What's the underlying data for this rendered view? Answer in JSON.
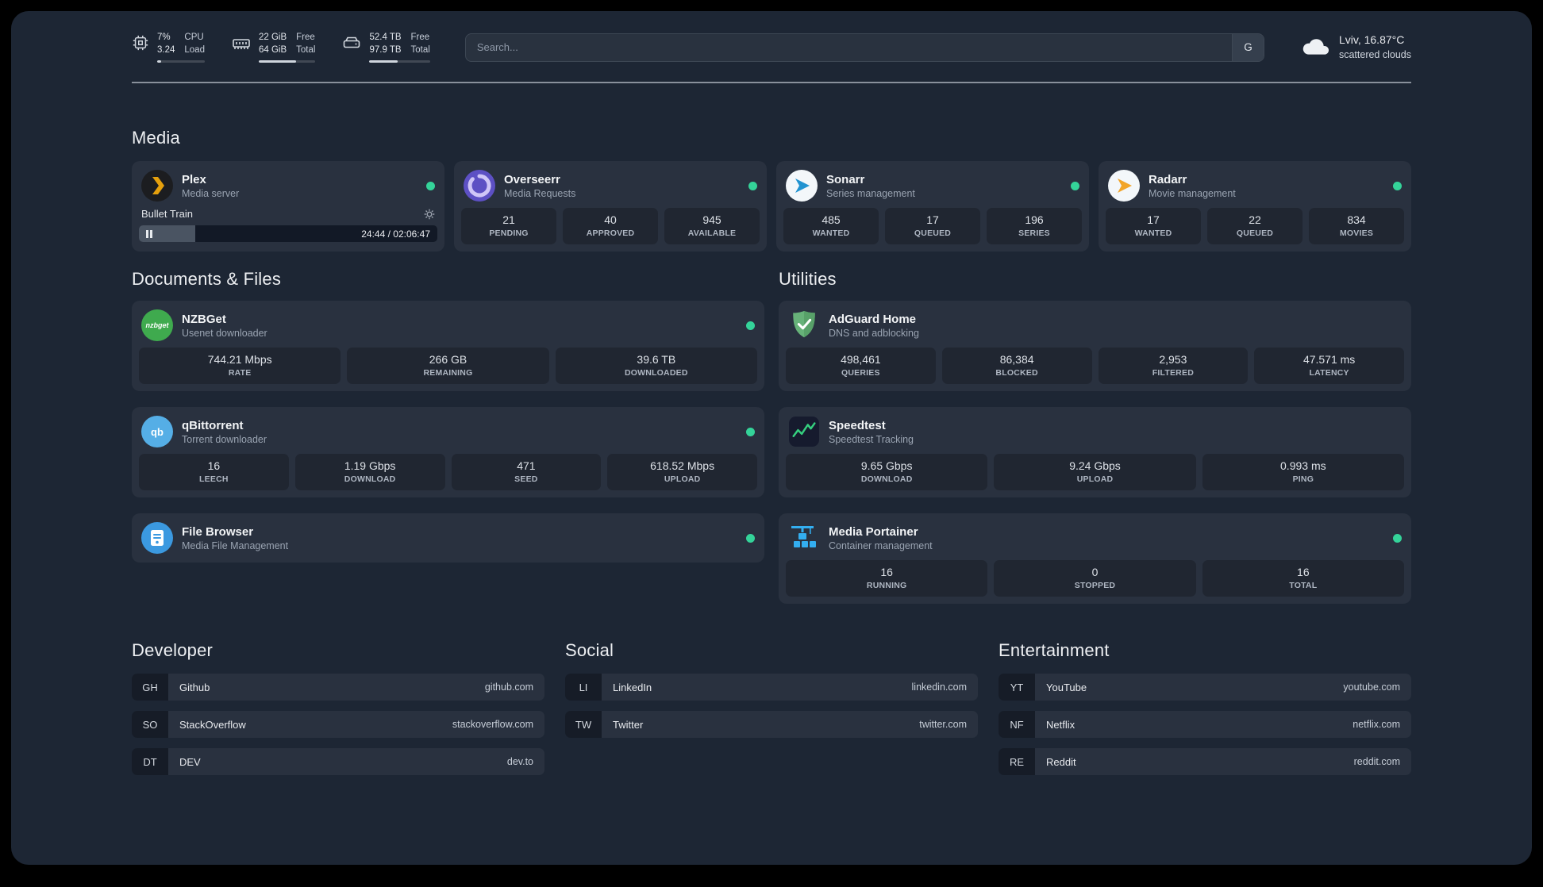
{
  "colors": {
    "status_online": "#34d399",
    "background": "#1d2634",
    "card": "#28303f",
    "plex_accent": "#e5a00d"
  },
  "topbar": {
    "cpu": {
      "percent": "7%",
      "load": "3.24",
      "label1": "CPU",
      "label2": "Load",
      "bar_percent": 9
    },
    "memory": {
      "free": "22 GiB",
      "total": "64 GiB",
      "label1": "Free",
      "label2": "Total",
      "bar_percent": 66
    },
    "disk": {
      "free": "52.4 TB",
      "total": "97.9 TB",
      "label1": "Free",
      "label2": "Total",
      "bar_percent": 46
    },
    "search": {
      "placeholder": "Search...",
      "provider": "G"
    },
    "weather": {
      "location": "Lviv, 16.87°C",
      "condition": "scattered clouds"
    }
  },
  "sections": {
    "media": "Media",
    "documents": "Documents & Files",
    "utilities": "Utilities"
  },
  "services": {
    "plex": {
      "name": "Plex",
      "desc": "Media server",
      "widget": {
        "track": "Bullet Train",
        "time": "24:44 / 02:06:47",
        "progress_percent": 19
      }
    },
    "overseerr": {
      "name": "Overseerr",
      "desc": "Media Requests",
      "stats": [
        {
          "value": "21",
          "label": "PENDING"
        },
        {
          "value": "40",
          "label": "APPROVED"
        },
        {
          "value": "945",
          "label": "AVAILABLE"
        }
      ]
    },
    "sonarr": {
      "name": "Sonarr",
      "desc": "Series management",
      "stats": [
        {
          "value": "485",
          "label": "WANTED"
        },
        {
          "value": "17",
          "label": "QUEUED"
        },
        {
          "value": "196",
          "label": "SERIES"
        }
      ]
    },
    "radarr": {
      "name": "Radarr",
      "desc": "Movie management",
      "stats": [
        {
          "value": "17",
          "label": "WANTED"
        },
        {
          "value": "22",
          "label": "QUEUED"
        },
        {
          "value": "834",
          "label": "MOVIES"
        }
      ]
    },
    "nzbget": {
      "name": "NZBGet",
      "desc": "Usenet downloader",
      "icon_text": "nzbget",
      "stats": [
        {
          "value": "744.21 Mbps",
          "label": "RATE"
        },
        {
          "value": "266 GB",
          "label": "REMAINING"
        },
        {
          "value": "39.6 TB",
          "label": "DOWNLOADED"
        }
      ]
    },
    "qbittorrent": {
      "name": "qBittorrent",
      "desc": "Torrent downloader",
      "icon_text": "qb",
      "stats": [
        {
          "value": "16",
          "label": "LEECH"
        },
        {
          "value": "1.19 Gbps",
          "label": "DOWNLOAD"
        },
        {
          "value": "471",
          "label": "SEED"
        },
        {
          "value": "618.52 Mbps",
          "label": "UPLOAD"
        }
      ]
    },
    "filebrowser": {
      "name": "File Browser",
      "desc": "Media File Management"
    },
    "adguard": {
      "name": "AdGuard Home",
      "desc": "DNS and adblocking",
      "stats": [
        {
          "value": "498,461",
          "label": "QUERIES"
        },
        {
          "value": "86,384",
          "label": "BLOCKED"
        },
        {
          "value": "2,953",
          "label": "FILTERED"
        },
        {
          "value": "47.571 ms",
          "label": "LATENCY"
        }
      ]
    },
    "speedtest": {
      "name": "Speedtest",
      "desc": "Speedtest Tracking",
      "stats": [
        {
          "value": "9.65 Gbps",
          "label": "DOWNLOAD"
        },
        {
          "value": "9.24 Gbps",
          "label": "UPLOAD"
        },
        {
          "value": "0.993 ms",
          "label": "PING"
        }
      ]
    },
    "portainer": {
      "name": "Media Portainer",
      "desc": "Container management",
      "stats": [
        {
          "value": "16",
          "label": "RUNNING"
        },
        {
          "value": "0",
          "label": "STOPPED"
        },
        {
          "value": "16",
          "label": "TOTAL"
        }
      ]
    }
  },
  "bookmarks": {
    "developer": {
      "title": "Developer",
      "items": [
        {
          "abbr": "GH",
          "name": "Github",
          "url": "github.com"
        },
        {
          "abbr": "SO",
          "name": "StackOverflow",
          "url": "stackoverflow.com"
        },
        {
          "abbr": "DT",
          "name": "DEV",
          "url": "dev.to"
        }
      ]
    },
    "social": {
      "title": "Social",
      "items": [
        {
          "abbr": "LI",
          "name": "LinkedIn",
          "url": "linkedin.com"
        },
        {
          "abbr": "TW",
          "name": "Twitter",
          "url": "twitter.com"
        }
      ]
    },
    "entertainment": {
      "title": "Entertainment",
      "items": [
        {
          "abbr": "YT",
          "name": "YouTube",
          "url": "youtube.com"
        },
        {
          "abbr": "NF",
          "name": "Netflix",
          "url": "netflix.com"
        },
        {
          "abbr": "RE",
          "name": "Reddit",
          "url": "reddit.com"
        }
      ]
    }
  }
}
